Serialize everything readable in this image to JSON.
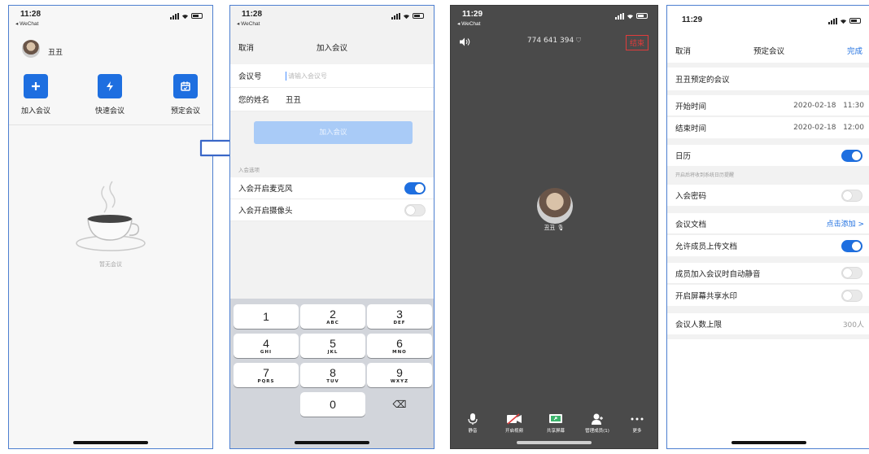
{
  "phone1": {
    "time": "11:28",
    "back": "◂ WeChat",
    "user_name": "丑丑",
    "actions": [
      "加入会议",
      "快速会议",
      "预定会议"
    ],
    "empty_text": "暂无会议"
  },
  "phone2": {
    "time": "11:28",
    "back": "◂ WeChat",
    "cancel": "取消",
    "title": "加入会议",
    "meeting_id_label": "会议号",
    "meeting_id_placeholder": "请输入会议号",
    "name_label": "您的姓名",
    "name_value": "丑丑",
    "join_button": "加入会议",
    "options_label": "入会选项",
    "options": [
      {
        "label": "入会开启麦克风",
        "on": true
      },
      {
        "label": "入会开启摄像头",
        "on": false
      }
    ],
    "keys": [
      {
        "n": "1",
        "s": ""
      },
      {
        "n": "2",
        "s": "ABC"
      },
      {
        "n": "3",
        "s": "DEF"
      },
      {
        "n": "4",
        "s": "GHI"
      },
      {
        "n": "5",
        "s": "JKL"
      },
      {
        "n": "6",
        "s": "MNO"
      },
      {
        "n": "7",
        "s": "PQRS"
      },
      {
        "n": "8",
        "s": "TUV"
      },
      {
        "n": "9",
        "s": "WXYZ"
      },
      {
        "n": "0",
        "s": ""
      }
    ],
    "backspace": "⌫"
  },
  "phone3": {
    "time": "11:29",
    "back": "◂ WeChat",
    "meeting_number": "774 641 394",
    "end_button": "结束",
    "participant_name": "丑丑",
    "toolbar": [
      "静音",
      "开启视频",
      "共享屏幕",
      "管理成员(1)",
      "更多"
    ]
  },
  "phone4": {
    "time": "11:29",
    "cancel": "取消",
    "title": "预定会议",
    "done": "完成",
    "meeting_topic": "丑丑预定的会议",
    "start_label": "开始时间",
    "start_date": "2020-02-18",
    "start_time": "11:30",
    "end_label": "结束时间",
    "end_date": "2020-02-18",
    "end_time": "12:00",
    "calendar_label": "日历",
    "calendar_note": "开启后将收到系统日历提醒",
    "password_label": "入会密码",
    "docs_label": "会议文档",
    "docs_action": "点击添加 >",
    "allow_upload_label": "允许成员上传文档",
    "auto_mute_label": "成员加入会议时自动静音",
    "watermark_label": "开启屏幕共享水印",
    "limit_label": "会议人数上限",
    "limit_value": "300人"
  },
  "colors": {
    "accent": "#1e6fe0",
    "join_disabled": "#a9cbf7",
    "end_red": "#e03c3c",
    "video_bg": "#4a4a4a",
    "arrow": "#3a67c8"
  }
}
